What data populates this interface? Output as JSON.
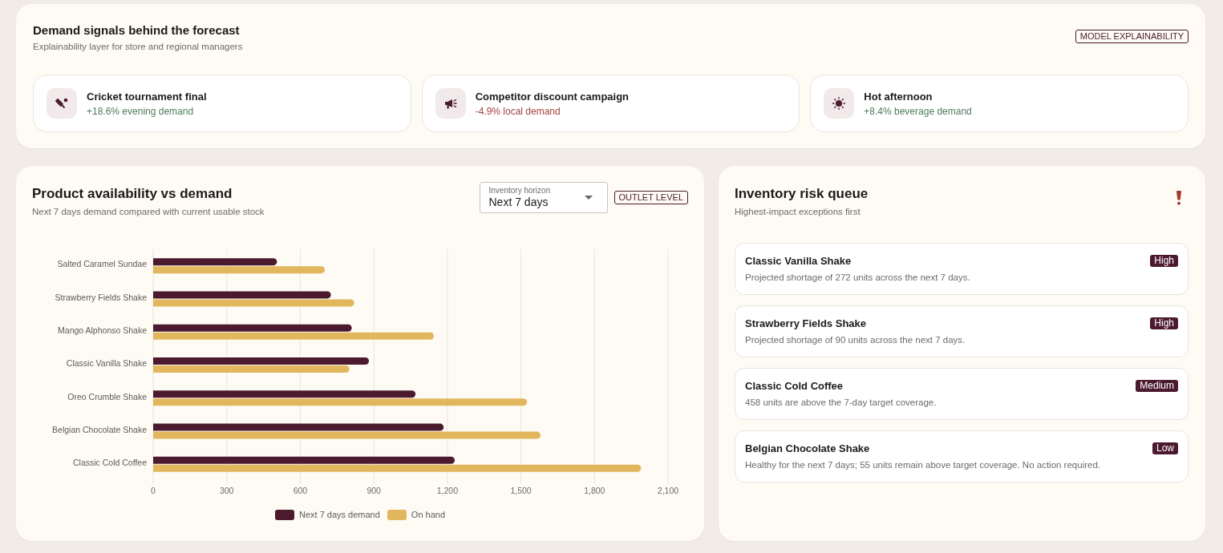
{
  "signals_panel": {
    "title": "Demand signals behind the forecast",
    "subtitle": "Explainability layer for store and regional managers",
    "badge": "MODEL EXPLAINABILITY",
    "signals": [
      {
        "kind": "cricket",
        "title": "Cricket tournament final",
        "effect": "+18.6% evening demand",
        "color": "#4e7b5d"
      },
      {
        "kind": "campaign",
        "title": "Competitor discount campaign",
        "effect": "-4.9% local demand",
        "color": "#a3443d"
      },
      {
        "kind": "weather",
        "title": "Hot afternoon",
        "effect": "+8.4% beverage demand",
        "color": "#4e7b5d"
      }
    ]
  },
  "availability_panel": {
    "title": "Product availability vs demand",
    "subtitle": "Next 7 days demand compared with current usable stock",
    "horizon_select": {
      "label": "Inventory horizon",
      "value": "Next 7 days"
    },
    "badge": "OUTLET LEVEL",
    "chart_data": {
      "type": "bar",
      "orientation": "horizontal",
      "grid": true,
      "legend": true,
      "categories": [
        "Salted Caramel Sundae",
        "Strawberry Fields Shake",
        "Mango Alphonso Shake",
        "Classic Vanilla Shake",
        "Oreo Crumble Shake",
        "Belgian Chocolate Shake",
        "Classic Cold Coffee"
      ],
      "series": [
        {
          "name": "Next 7 days demand",
          "color": "#4b1a2f",
          "values": [
            505,
            725,
            810,
            880,
            1070,
            1185,
            1230
          ]
        },
        {
          "name": "On hand",
          "color": "#e2b65c",
          "values": [
            700,
            820,
            1145,
            800,
            1525,
            1580,
            1990
          ]
        }
      ],
      "xlim": [
        0,
        2100
      ],
      "xticks": [
        0,
        300,
        600,
        900,
        {
          "value": 1200,
          "label": "1,200"
        },
        {
          "value": 1500,
          "label": "1,500"
        },
        {
          "value": 1800,
          "label": "1,800"
        },
        {
          "value": 2100,
          "label": "2,100"
        }
      ]
    }
  },
  "risk_panel": {
    "title": "Inventory risk queue",
    "subtitle": "Highest-impact exceptions first",
    "items": [
      {
        "title": "Classic Vanilla Shake",
        "description": "Projected shortage of 272 units across the next 7 days.",
        "severity": "High"
      },
      {
        "title": "Strawberry Fields Shake",
        "description": "Projected shortage of 90 units across the next 7 days.",
        "severity": "High"
      },
      {
        "title": "Classic Cold Coffee",
        "description": "458 units are above the 7-day target coverage.",
        "severity": "Medium"
      },
      {
        "title": "Belgian Chocolate Shake",
        "description": "Healthy for the next 7 days; 55 units remain above target coverage. No action required.",
        "severity": "Low"
      }
    ]
  }
}
